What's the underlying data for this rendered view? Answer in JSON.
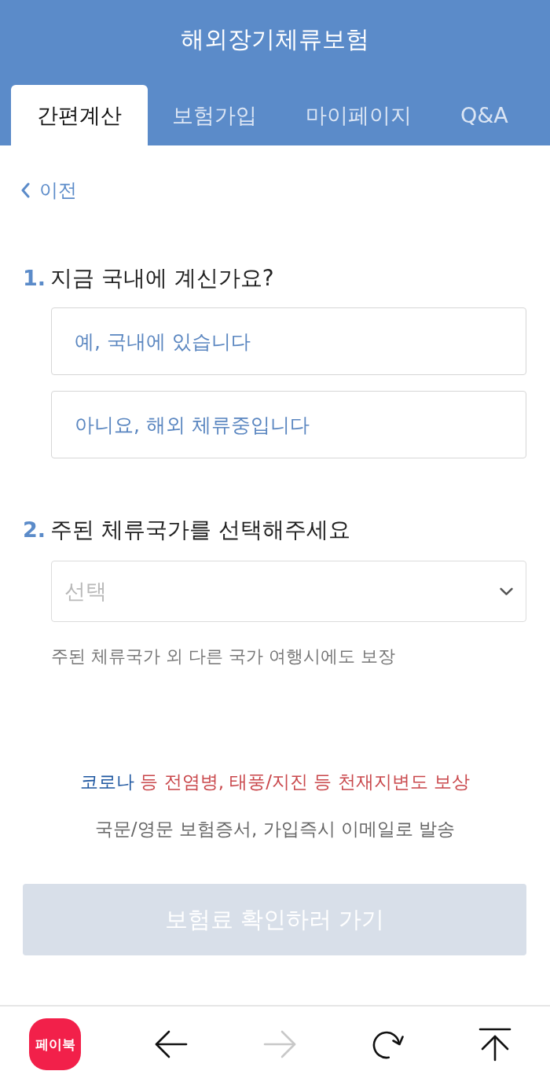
{
  "header": {
    "title": "해외장기체류보험"
  },
  "tabs": [
    {
      "label": "간편계산",
      "selected": true
    },
    {
      "label": "보험가입",
      "selected": false
    },
    {
      "label": "마이페이지",
      "selected": false
    },
    {
      "label": "Q&A",
      "selected": false
    }
  ],
  "back_link": {
    "label": "이전"
  },
  "questions": [
    {
      "kind": "options",
      "number": "1.",
      "text": "지금 국내에 계신가요?",
      "options": [
        {
          "label": "예, 국내에 있습니다",
          "selected": false
        },
        {
          "label": "아니요, 해외 체류중입니다",
          "selected": false
        }
      ]
    },
    {
      "kind": "select",
      "number": "2.",
      "text": "주된 체류국가를 선택해주세요",
      "placeholder": "선택",
      "hint": "주된 체류국가 외 다른 국가 여행시에도 보장"
    }
  ],
  "notices": [
    {
      "highlight": "코로나",
      "text": "등 전염병, 태풍/지진 등 천재지변도 보상"
    },
    {
      "text": "국문/영문 보험증서, 가입즉시 이메일로 발송"
    }
  ],
  "submit_button": {
    "label": "보험료 확인하러 가기",
    "disabled": true
  },
  "bottom_bar": [
    {
      "kind": "app",
      "label": "페이북"
    },
    {
      "kind": "back",
      "disabled": false
    },
    {
      "kind": "forward",
      "disabled": true
    },
    {
      "kind": "reload",
      "disabled": false
    },
    {
      "kind": "top",
      "disabled": false
    }
  ]
}
